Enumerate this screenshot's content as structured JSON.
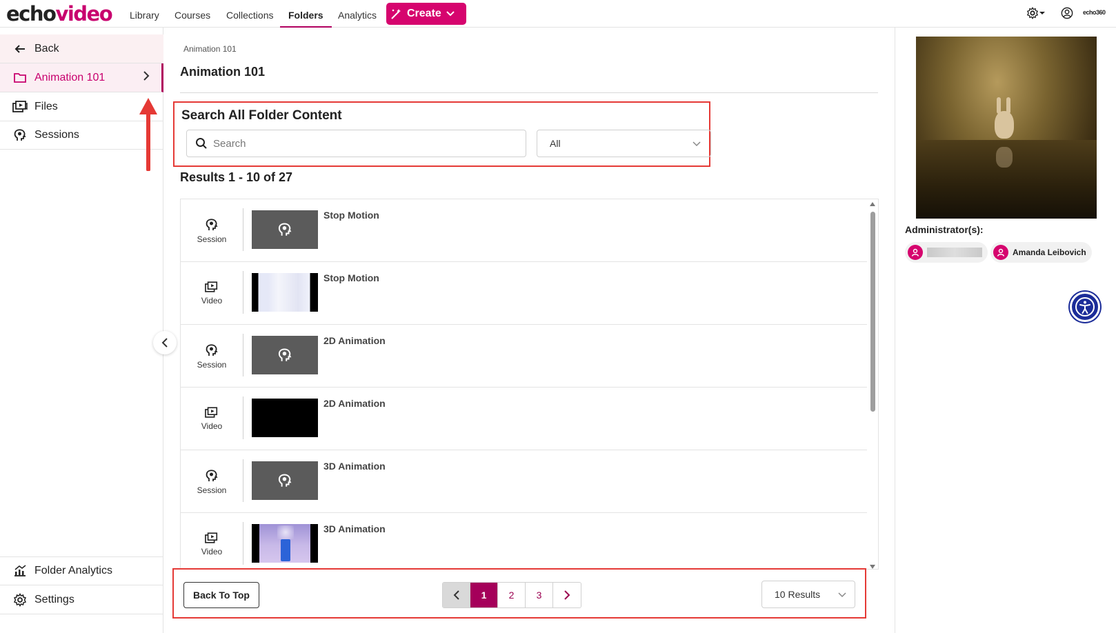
{
  "brand": {
    "echo": "echo",
    "video": "video",
    "small_logo": "echo360"
  },
  "nav": {
    "items": [
      "Library",
      "Courses",
      "Collections",
      "Folders",
      "Analytics"
    ],
    "active": "Folders",
    "create_label": "Create"
  },
  "sidebar": {
    "back_label": "Back",
    "items": [
      {
        "label": "Animation 101",
        "icon": "folder-icon",
        "active": true
      },
      {
        "label": "Files",
        "icon": "video-library-icon"
      },
      {
        "label": "Sessions",
        "icon": "session-head-icon"
      }
    ],
    "bottom_items": [
      {
        "label": "Folder Analytics",
        "icon": "analytics-icon"
      },
      {
        "label": "Settings",
        "icon": "gear-icon"
      }
    ]
  },
  "main": {
    "breadcrumb": "Animation 101",
    "title": "Animation 101",
    "search": {
      "heading": "Search All Folder Content",
      "placeholder": "Search",
      "filter_value": "All"
    },
    "results_text": "Results 1 - 10 of 27",
    "rows": [
      {
        "type": "Session",
        "title": "Stop Motion",
        "thumb": "session"
      },
      {
        "type": "Video",
        "title": "Stop Motion",
        "thumb": "video-light"
      },
      {
        "type": "Session",
        "title": "2D Animation",
        "thumb": "session"
      },
      {
        "type": "Video",
        "title": "2D Animation",
        "thumb": "black"
      },
      {
        "type": "Session",
        "title": "3D Animation",
        "thumb": "session"
      },
      {
        "type": "Video",
        "title": "3D Animation",
        "thumb": "video-bottle"
      }
    ],
    "footer": {
      "back_to_top": "Back To Top",
      "pages": [
        "1",
        "2",
        "3"
      ],
      "current_page": "1",
      "per_page": "10 Results"
    }
  },
  "right_panel": {
    "admin_label": "Administrator(s):",
    "admins": [
      "Amanda Leibovich"
    ]
  },
  "colors": {
    "brand_magenta": "#d6046e",
    "active_dark_magenta": "#a5005a",
    "annotation_red": "#e53935",
    "a11y_blue": "#1c2d99"
  }
}
